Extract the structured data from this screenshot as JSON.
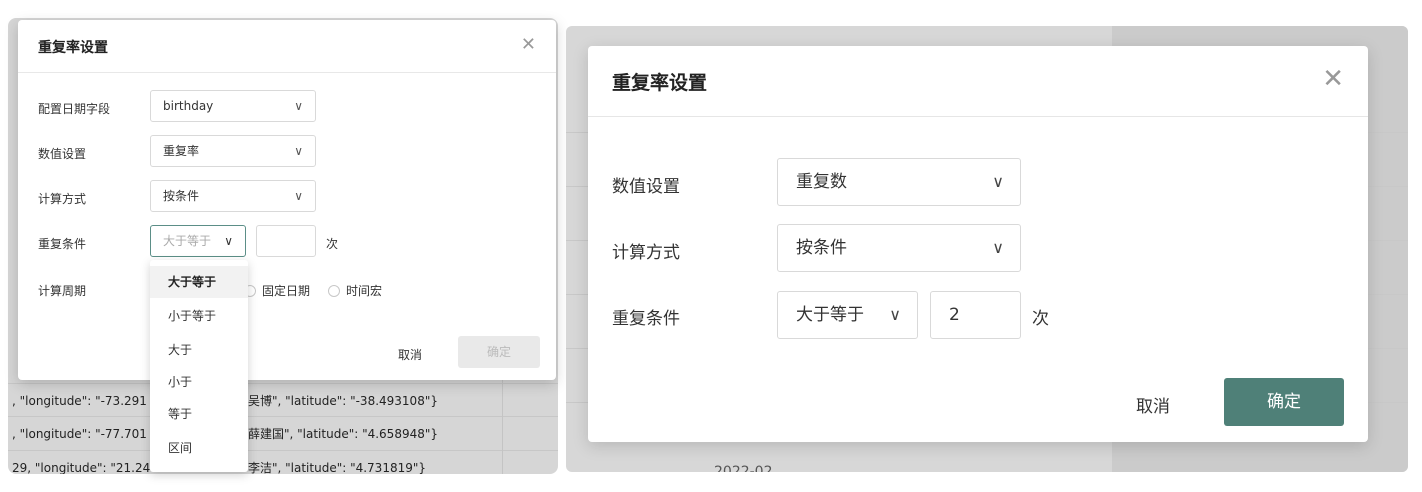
{
  "left": {
    "title": "重复率设置",
    "close_icon": "close-icon",
    "fields": {
      "date_field_label": "配置日期字段",
      "date_field_value": "birthday",
      "value_label": "数值设置",
      "value_value": "重复率",
      "calc_label": "计算方式",
      "calc_value": "按条件",
      "repeat_label": "重复条件",
      "repeat_value": "大于等于",
      "repeat_unit": "次",
      "period_label": "计算周期",
      "radio_fixed": "固定日期",
      "radio_macro": "时间宏"
    },
    "dropdown": [
      "大于等于",
      "小于等于",
      "大于",
      "小于",
      "等于",
      "区间"
    ],
    "cancel": "取消",
    "ok": "确定",
    "bg_rows": [
      ", \"longitude\": \"-73.291",
      "吴博\", \"latitude\": \"-38.493108\"}",
      ", \"longitude\": \"-77.701",
      "薛建国\", \"latitude\": \"4.658948\"}",
      "29, \"longitude\": \"21.24",
      "李洁\", \"latitude\": \"4.731819\"}"
    ]
  },
  "right": {
    "title": "重复率设置",
    "close_icon": "close-icon",
    "value_label": "数值设置",
    "value_value": "重复数",
    "calc_label": "计算方式",
    "calc_value": "按条件",
    "repeat_label": "重复条件",
    "repeat_value": "大于等于",
    "repeat_count": "2",
    "repeat_unit": "次",
    "cancel": "取消",
    "ok": "确定",
    "bg_text": "2022-02"
  },
  "colors": {
    "primary": "#4f8078",
    "disabled_bg": "#e9e9e9"
  }
}
